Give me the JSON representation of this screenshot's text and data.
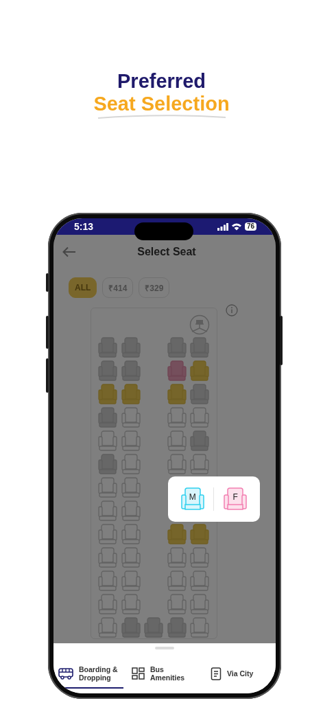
{
  "promo": {
    "title_line_1": "Preferred",
    "title_line_2": "Seat Selection"
  },
  "status_bar": {
    "time": "5:13",
    "battery": "76"
  },
  "header": {
    "title": "Select Seat"
  },
  "price_filters": [
    {
      "label": "ALL",
      "selected": true
    },
    {
      "label": "₹414",
      "selected": false
    },
    {
      "label": "₹329",
      "selected": false
    }
  ],
  "seat_rows": [
    {
      "left": [
        {
          "kind": "blocked"
        },
        {
          "kind": "blocked"
        }
      ],
      "right": [
        {
          "kind": "blocked"
        },
        {
          "kind": "blocked"
        }
      ]
    },
    {
      "left": [
        {
          "kind": "blocked"
        },
        {
          "kind": "blocked"
        }
      ],
      "right": [
        {
          "kind": "ladies"
        },
        {
          "kind": "booked"
        }
      ]
    },
    {
      "left": [
        {
          "kind": "booked"
        },
        {
          "kind": "booked"
        }
      ],
      "right": [
        {
          "kind": "booked"
        },
        {
          "kind": "blocked"
        }
      ]
    },
    {
      "left": [
        {
          "kind": "blocked"
        },
        {
          "kind": "available"
        }
      ],
      "right": [
        {
          "kind": "available"
        },
        {
          "kind": "available"
        }
      ]
    },
    {
      "left": [
        {
          "kind": "available"
        },
        {
          "kind": "available"
        }
      ],
      "right": [
        {
          "kind": "available"
        },
        {
          "kind": "blocked"
        }
      ]
    },
    {
      "left": [
        {
          "kind": "blocked"
        },
        {
          "kind": "available"
        }
      ],
      "right": [
        {
          "kind": "available"
        },
        {
          "kind": "available"
        }
      ]
    },
    {
      "left": [
        {
          "kind": "available"
        },
        {
          "kind": "available"
        }
      ]
    },
    {
      "left": [
        {
          "kind": "available"
        },
        {
          "kind": "available"
        }
      ]
    },
    {
      "left": [
        {
          "kind": "available"
        },
        {
          "kind": "available"
        }
      ],
      "right": [
        {
          "kind": "booked"
        },
        {
          "kind": "booked"
        }
      ]
    },
    {
      "left": [
        {
          "kind": "available"
        },
        {
          "kind": "available"
        }
      ],
      "right": [
        {
          "kind": "available"
        },
        {
          "kind": "available"
        }
      ]
    },
    {
      "left": [
        {
          "kind": "available"
        },
        {
          "kind": "available"
        }
      ],
      "right": [
        {
          "kind": "available"
        },
        {
          "kind": "available"
        }
      ]
    },
    {
      "left": [
        {
          "kind": "available"
        },
        {
          "kind": "available"
        }
      ],
      "right": [
        {
          "kind": "available"
        },
        {
          "kind": "available"
        }
      ]
    },
    {
      "left": [
        {
          "kind": "available"
        },
        {
          "kind": "blocked"
        }
      ],
      "middle": {
        "kind": "blocked"
      },
      "right": [
        {
          "kind": "blocked"
        },
        {
          "kind": "available"
        }
      ]
    }
  ],
  "gender_popup": {
    "options": [
      {
        "label": "M",
        "kind": "male"
      },
      {
        "label": "F",
        "kind": "female"
      }
    ]
  },
  "bottom_tabs": [
    {
      "label": "Boarding & Dropping",
      "selected": true
    },
    {
      "label": "Bus Amenities",
      "selected": false
    },
    {
      "label": "Via City",
      "selected": false
    }
  ]
}
